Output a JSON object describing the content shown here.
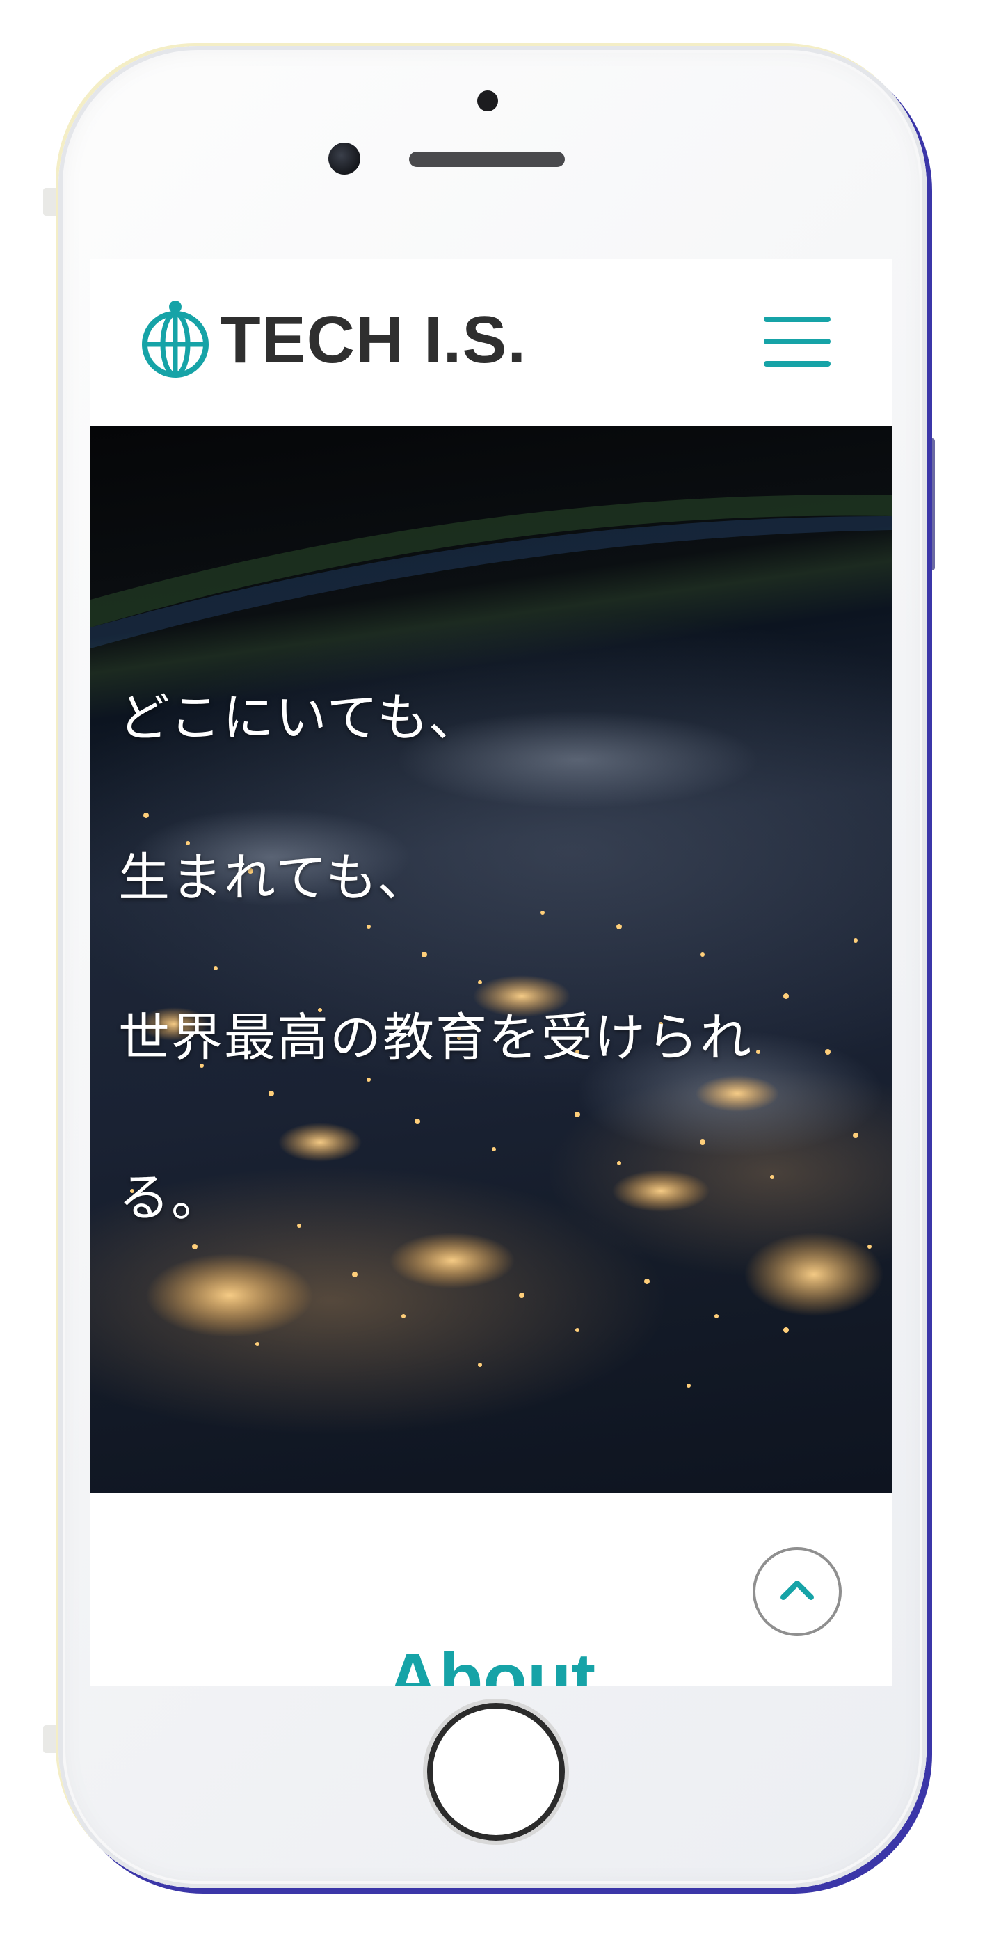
{
  "header": {
    "logo_text": "TECH I.S.",
    "logo_icon": "globe-icon",
    "menu_icon": "hamburger-menu-icon"
  },
  "hero": {
    "lines": [
      "どこにいても、",
      "生まれても、",
      "世界最高の教育を受けられ",
      "る。"
    ]
  },
  "scroll_top": {
    "icon": "chevron-up-icon"
  },
  "section": {
    "title": "About"
  },
  "colors": {
    "accent": "#16a3a7",
    "logo_text": "#2f2f2f",
    "hero_text": "#ffffff"
  }
}
